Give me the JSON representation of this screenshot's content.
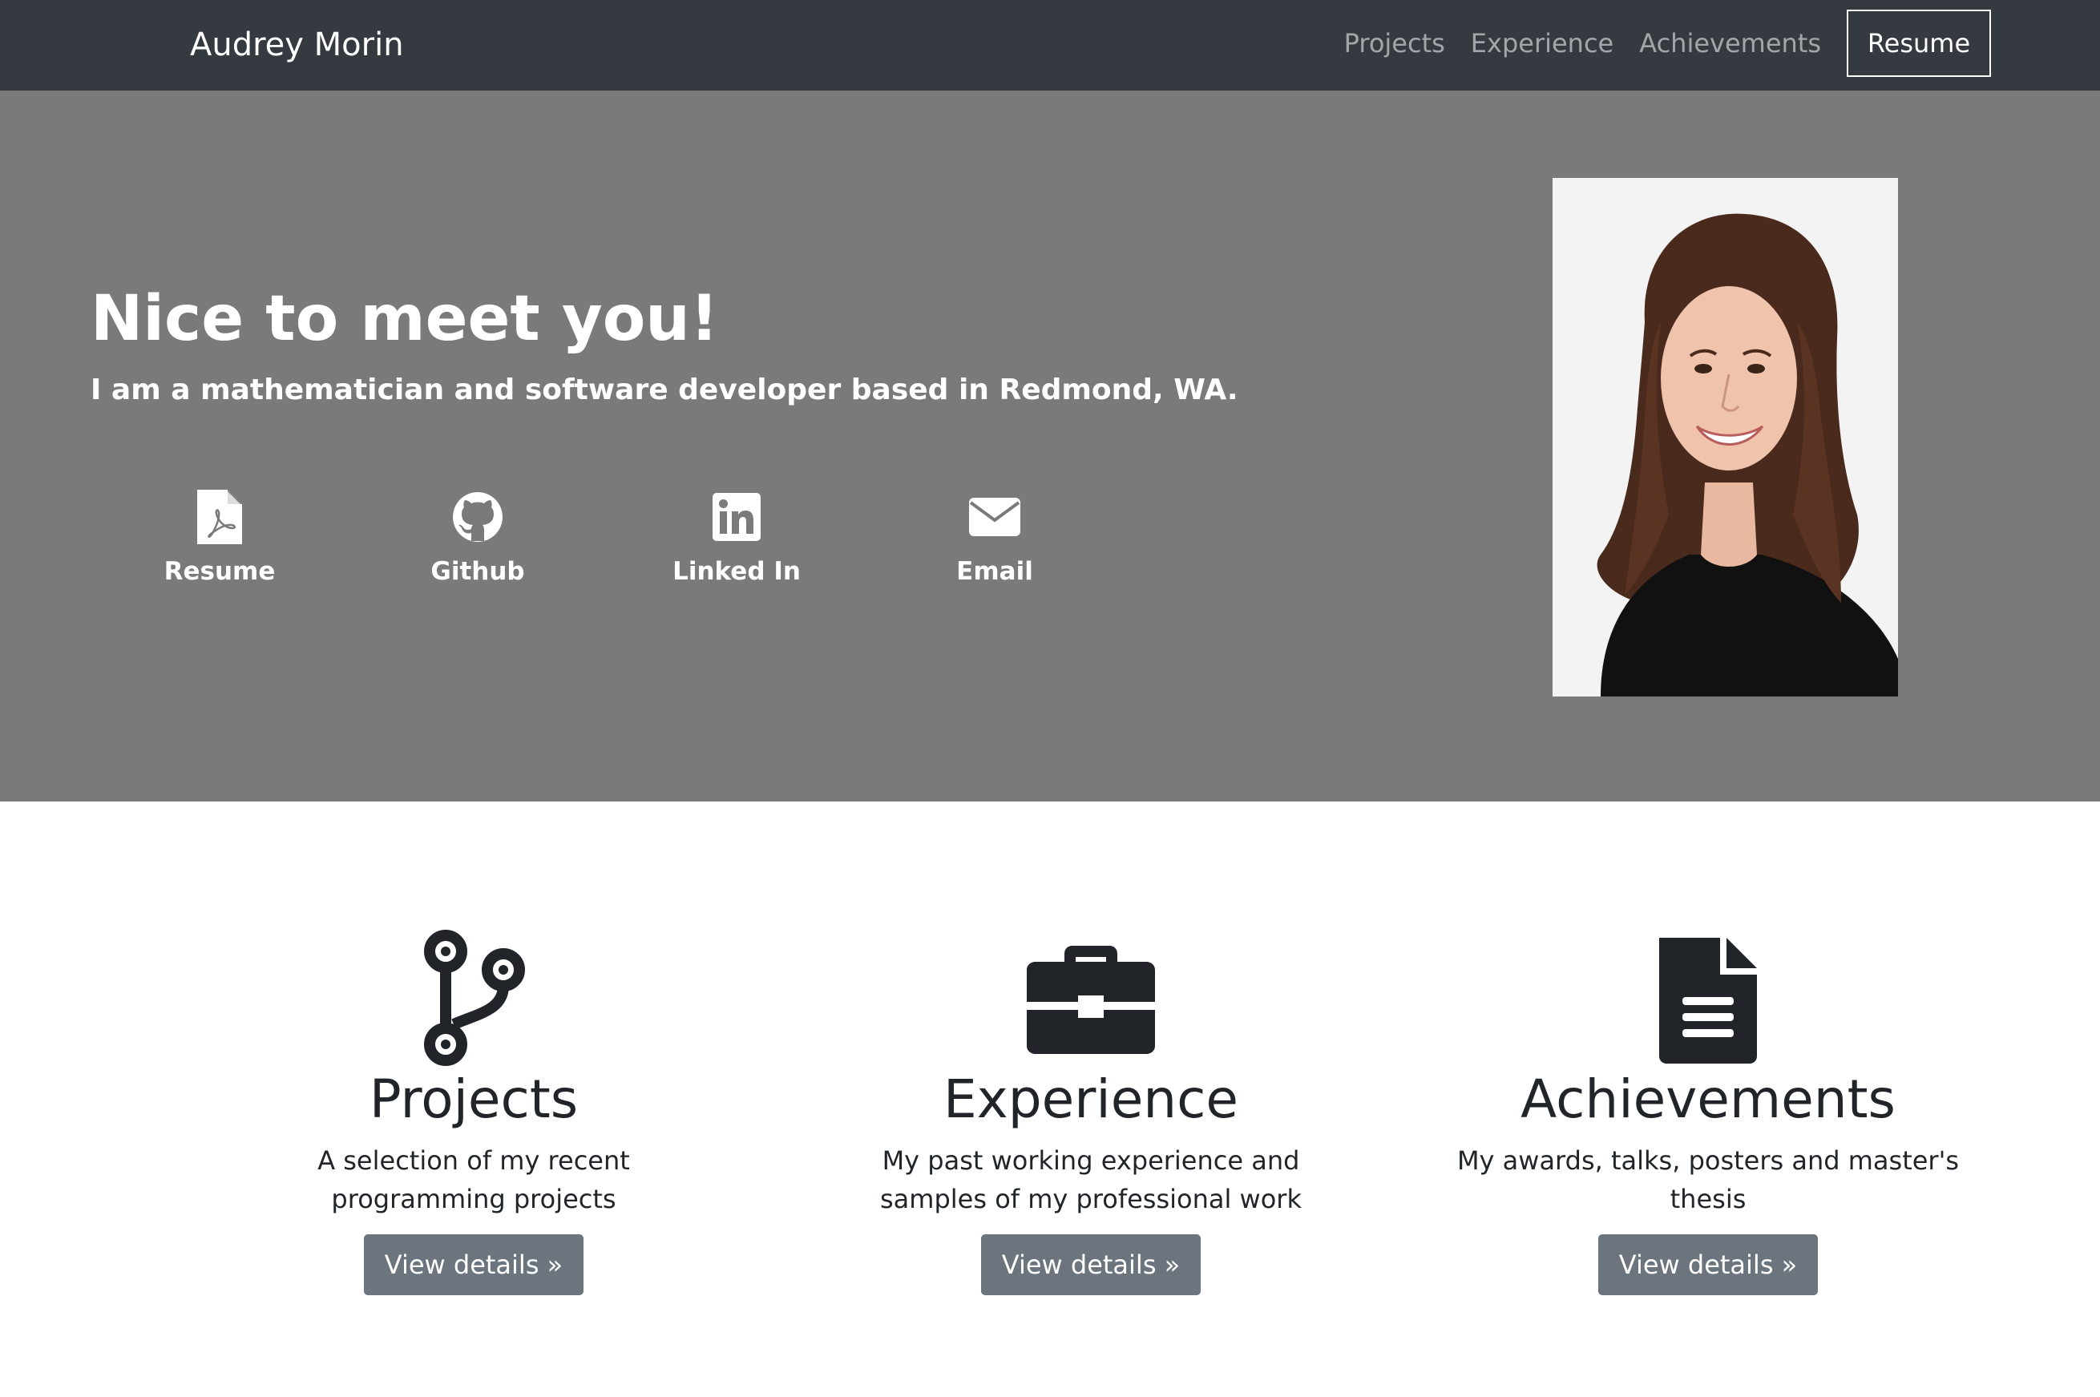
{
  "navbar": {
    "brand": "Audrey Morin",
    "links": [
      "Projects",
      "Experience",
      "Achievements"
    ],
    "resume_button": "Resume",
    "background": "#343a40"
  },
  "hero": {
    "title": "Nice to meet you!",
    "subtitle": "I am a mathematician and software developer based in Redmond, WA.",
    "background": "#7a7a7a",
    "social": [
      {
        "label": "Resume",
        "icon": "pdf-file-icon"
      },
      {
        "label": "Github",
        "icon": "github-icon"
      },
      {
        "label": "Linked In",
        "icon": "linkedin-icon"
      },
      {
        "label": "Email",
        "icon": "envelope-icon"
      }
    ],
    "photo_icon": "profile-photo"
  },
  "features": [
    {
      "icon": "code-branch-icon",
      "title": "Projects",
      "description": "A selection of my recent programming projects",
      "button": "View details »"
    },
    {
      "icon": "briefcase-icon",
      "title": "Experience",
      "description": "My past working experience and samples of my professional work",
      "button": "View details »"
    },
    {
      "icon": "document-icon",
      "title": "Achievements",
      "description": "My awards, talks, posters and master's thesis",
      "button": "View details »"
    }
  ]
}
